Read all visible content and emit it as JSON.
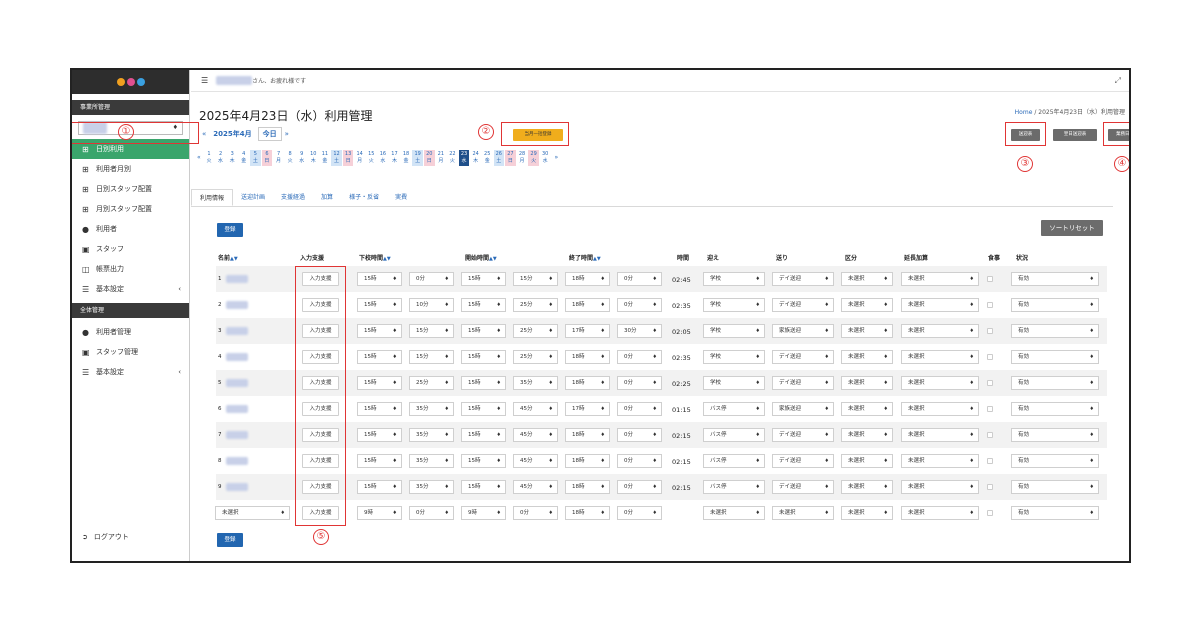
{
  "sidebar": {
    "sections": [
      {
        "label": "事業所管理"
      },
      {
        "label": "全体管理"
      }
    ],
    "shop_select": "",
    "items": [
      {
        "label": "日別利用",
        "icon": "grid-icon"
      },
      {
        "label": "利用者月別",
        "icon": "grid-icon"
      },
      {
        "label": "日別スタッフ配置",
        "icon": "grid-icon"
      },
      {
        "label": "月別スタッフ配置",
        "icon": "grid-icon"
      },
      {
        "label": "利用者",
        "icon": "user-icon"
      },
      {
        "label": "スタッフ",
        "icon": "id-card-icon"
      },
      {
        "label": "帳票出力",
        "icon": "copy-icon"
      },
      {
        "label": "基本設定",
        "icon": "database-icon"
      },
      {
        "label": "利用者管理",
        "icon": "user-icon"
      },
      {
        "label": "スタッフ管理",
        "icon": "id-card-icon"
      },
      {
        "label": "基本設定",
        "icon": "database-icon"
      }
    ],
    "chevron": "‹",
    "logout": "ログアウト"
  },
  "topbar": {
    "greeting": "さん、お疲れ様です"
  },
  "page": {
    "title": "2025年4月23日（水）利用管理",
    "breadcrumb_home": "Home",
    "breadcrumb_sep": "/",
    "breadcrumb_current": "2025年4月23日（水）利用管理",
    "month": "2025年4月",
    "today": "今日",
    "prev": "«",
    "next": "»",
    "bulk_register": "当月一括登録",
    "transport_table": "送迎表",
    "next_day_transport": "翌日送迎表",
    "daily_report": "業務日報"
  },
  "calendar": [
    {
      "d": "1",
      "w": "火",
      "t": ""
    },
    {
      "d": "2",
      "w": "水",
      "t": ""
    },
    {
      "d": "3",
      "w": "木",
      "t": ""
    },
    {
      "d": "4",
      "w": "金",
      "t": ""
    },
    {
      "d": "5",
      "w": "土",
      "t": "sat"
    },
    {
      "d": "6",
      "w": "日",
      "t": "sun"
    },
    {
      "d": "7",
      "w": "月",
      "t": ""
    },
    {
      "d": "8",
      "w": "火",
      "t": ""
    },
    {
      "d": "9",
      "w": "水",
      "t": ""
    },
    {
      "d": "10",
      "w": "木",
      "t": ""
    },
    {
      "d": "11",
      "w": "金",
      "t": ""
    },
    {
      "d": "12",
      "w": "土",
      "t": "sat"
    },
    {
      "d": "13",
      "w": "日",
      "t": "sun"
    },
    {
      "d": "14",
      "w": "月",
      "t": ""
    },
    {
      "d": "15",
      "w": "火",
      "t": ""
    },
    {
      "d": "16",
      "w": "水",
      "t": ""
    },
    {
      "d": "17",
      "w": "木",
      "t": ""
    },
    {
      "d": "18",
      "w": "金",
      "t": ""
    },
    {
      "d": "19",
      "w": "土",
      "t": "sat"
    },
    {
      "d": "20",
      "w": "日",
      "t": "sun"
    },
    {
      "d": "21",
      "w": "月",
      "t": ""
    },
    {
      "d": "22",
      "w": "火",
      "t": ""
    },
    {
      "d": "23",
      "w": "水",
      "t": "cur"
    },
    {
      "d": "24",
      "w": "木",
      "t": ""
    },
    {
      "d": "25",
      "w": "金",
      "t": ""
    },
    {
      "d": "26",
      "w": "土",
      "t": "sat"
    },
    {
      "d": "27",
      "w": "日",
      "t": "sun"
    },
    {
      "d": "28",
      "w": "月",
      "t": ""
    },
    {
      "d": "29",
      "w": "火",
      "t": "sun"
    },
    {
      "d": "30",
      "w": "水",
      "t": ""
    }
  ],
  "tabs": [
    "利用情報",
    "送迎計画",
    "支援経過",
    "加算",
    "様子・反省",
    "実費"
  ],
  "register_label": "登録",
  "sort_reset": "ソートリセット",
  "sort_icon": "▲▼",
  "headers": {
    "name": "名前",
    "input_support": "入力支援",
    "school_end": "下校時間",
    "start": "開始時間",
    "end": "終了時間",
    "duration": "時間",
    "pickup": "迎え",
    "dropoff": "送り",
    "category": "区分",
    "extension": "延長加算",
    "meal": "食事",
    "status": "状況"
  },
  "input_support_label": "入力支援",
  "rows": [
    {
      "no": "1",
      "sh": "15時",
      "sm": "0分",
      "st": "15時",
      "stm": "15分",
      "eh": "18時",
      "em": "0分",
      "dur": "02:45",
      "pick": "学校",
      "drop": "デイ送迎",
      "cat": "未選択",
      "ext": "未選択",
      "status": "有効"
    },
    {
      "no": "2",
      "sh": "15時",
      "sm": "10分",
      "st": "15時",
      "stm": "25分",
      "eh": "18時",
      "em": "0分",
      "dur": "02:35",
      "pick": "学校",
      "drop": "デイ送迎",
      "cat": "未選択",
      "ext": "未選択",
      "status": "有効"
    },
    {
      "no": "3",
      "sh": "15時",
      "sm": "15分",
      "st": "15時",
      "stm": "25分",
      "eh": "17時",
      "em": "30分",
      "dur": "02:05",
      "pick": "学校",
      "drop": "家族送迎",
      "cat": "未選択",
      "ext": "未選択",
      "status": "有効"
    },
    {
      "no": "4",
      "sh": "15時",
      "sm": "15分",
      "st": "15時",
      "stm": "25分",
      "eh": "18時",
      "em": "0分",
      "dur": "02:35",
      "pick": "学校",
      "drop": "デイ送迎",
      "cat": "未選択",
      "ext": "未選択",
      "status": "有効"
    },
    {
      "no": "5",
      "sh": "15時",
      "sm": "25分",
      "st": "15時",
      "stm": "35分",
      "eh": "18時",
      "em": "0分",
      "dur": "02:25",
      "pick": "学校",
      "drop": "デイ送迎",
      "cat": "未選択",
      "ext": "未選択",
      "status": "有効"
    },
    {
      "no": "6",
      "sh": "15時",
      "sm": "35分",
      "st": "15時",
      "stm": "45分",
      "eh": "17時",
      "em": "0分",
      "dur": "01:15",
      "pick": "バス停",
      "drop": "家族送迎",
      "cat": "未選択",
      "ext": "未選択",
      "status": "有効"
    },
    {
      "no": "7",
      "sh": "15時",
      "sm": "35分",
      "st": "15時",
      "stm": "45分",
      "eh": "18時",
      "em": "0分",
      "dur": "02:15",
      "pick": "バス停",
      "drop": "デイ送迎",
      "cat": "未選択",
      "ext": "未選択",
      "status": "有効"
    },
    {
      "no": "8",
      "sh": "15時",
      "sm": "35分",
      "st": "15時",
      "stm": "45分",
      "eh": "18時",
      "em": "0分",
      "dur": "02:15",
      "pick": "バス停",
      "drop": "デイ送迎",
      "cat": "未選択",
      "ext": "未選択",
      "status": "有効"
    },
    {
      "no": "9",
      "sh": "15時",
      "sm": "35分",
      "st": "15時",
      "stm": "45分",
      "eh": "18時",
      "em": "0分",
      "dur": "02:15",
      "pick": "バス停",
      "drop": "デイ送迎",
      "cat": "未選択",
      "ext": "未選択",
      "status": "有効"
    }
  ],
  "new_row": {
    "name": "未選択",
    "sh": "9時",
    "sm": "0分",
    "st": "9時",
    "stm": "0分",
    "eh": "18時",
    "em": "0分",
    "pick": "未選択",
    "drop": "未選択",
    "cat": "未選択",
    "ext": "未選択",
    "status": "有効"
  },
  "annotations": [
    "①",
    "②",
    "③",
    "④",
    "⑤"
  ],
  "colors": {
    "accent": "#2266b0",
    "active_nav": "#3aa56c",
    "bulk": "#f0ad1c",
    "annotation": "#e03535"
  }
}
